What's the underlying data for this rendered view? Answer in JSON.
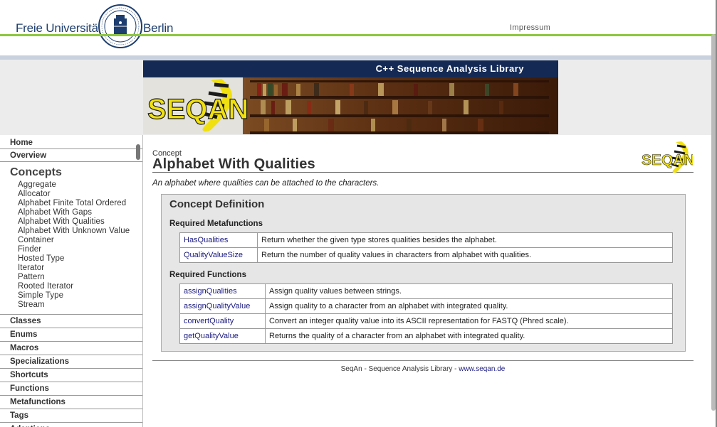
{
  "header": {
    "name_left": "Freie Universität",
    "name_right": "Berlin",
    "impressum": "Impressum"
  },
  "banner": {
    "title": "C++ Sequence Analysis Library",
    "logo_text": "SEQAN"
  },
  "sidebar": {
    "home": "Home",
    "overview": "Overview",
    "concepts_head": "Concepts",
    "concepts": [
      "Aggregate",
      "Allocator",
      "Alphabet Finite Total Ordered",
      "Alphabet With Gaps",
      "Alphabet With Qualities",
      "Alphabet With Unknown Value",
      "Container",
      "Finder",
      "Hosted Type",
      "Iterator",
      "Pattern",
      "Rooted Iterator",
      "Simple Type",
      "Stream"
    ],
    "sections": [
      "Classes",
      "Enums",
      "Macros",
      "Specializations",
      "Shortcuts",
      "Functions",
      "Metafunctions",
      "Tags",
      "Adaptions"
    ]
  },
  "main": {
    "kicker": "Concept",
    "title": "Alphabet With Qualities",
    "description": "An alphabet where qualities can be attached to the characters.",
    "box_title": "Concept Definition",
    "meta_label": "Required Metafunctions",
    "metafunctions": [
      {
        "name": "HasQualities",
        "desc": "Return whether the given type stores qualities besides the alphabet."
      },
      {
        "name": "QualityValueSize",
        "desc": "Return the number of quality values in characters from alphabet with qualities."
      }
    ],
    "func_label": "Required Functions",
    "functions": [
      {
        "name": "assignQualities",
        "desc": "Assign quality values between strings."
      },
      {
        "name": "assignQualityValue",
        "desc": "Assign quality to a character from an alphabet with integrated quality."
      },
      {
        "name": "convertQuality",
        "desc": "Convert an integer quality value into its ASCII representation for FASTQ (Phred scale)."
      },
      {
        "name": "getQualityValue",
        "desc": "Returns the quality of a character from an alphabet with integrated quality."
      }
    ],
    "footer_text": "SeqAn - Sequence Analysis Library - ",
    "footer_link": "www.seqan.de"
  },
  "colors": {
    "navy": "#142a55",
    "green": "#8ec63f",
    "logo_yellow": "#f0e010",
    "link": "#1a1a80"
  }
}
